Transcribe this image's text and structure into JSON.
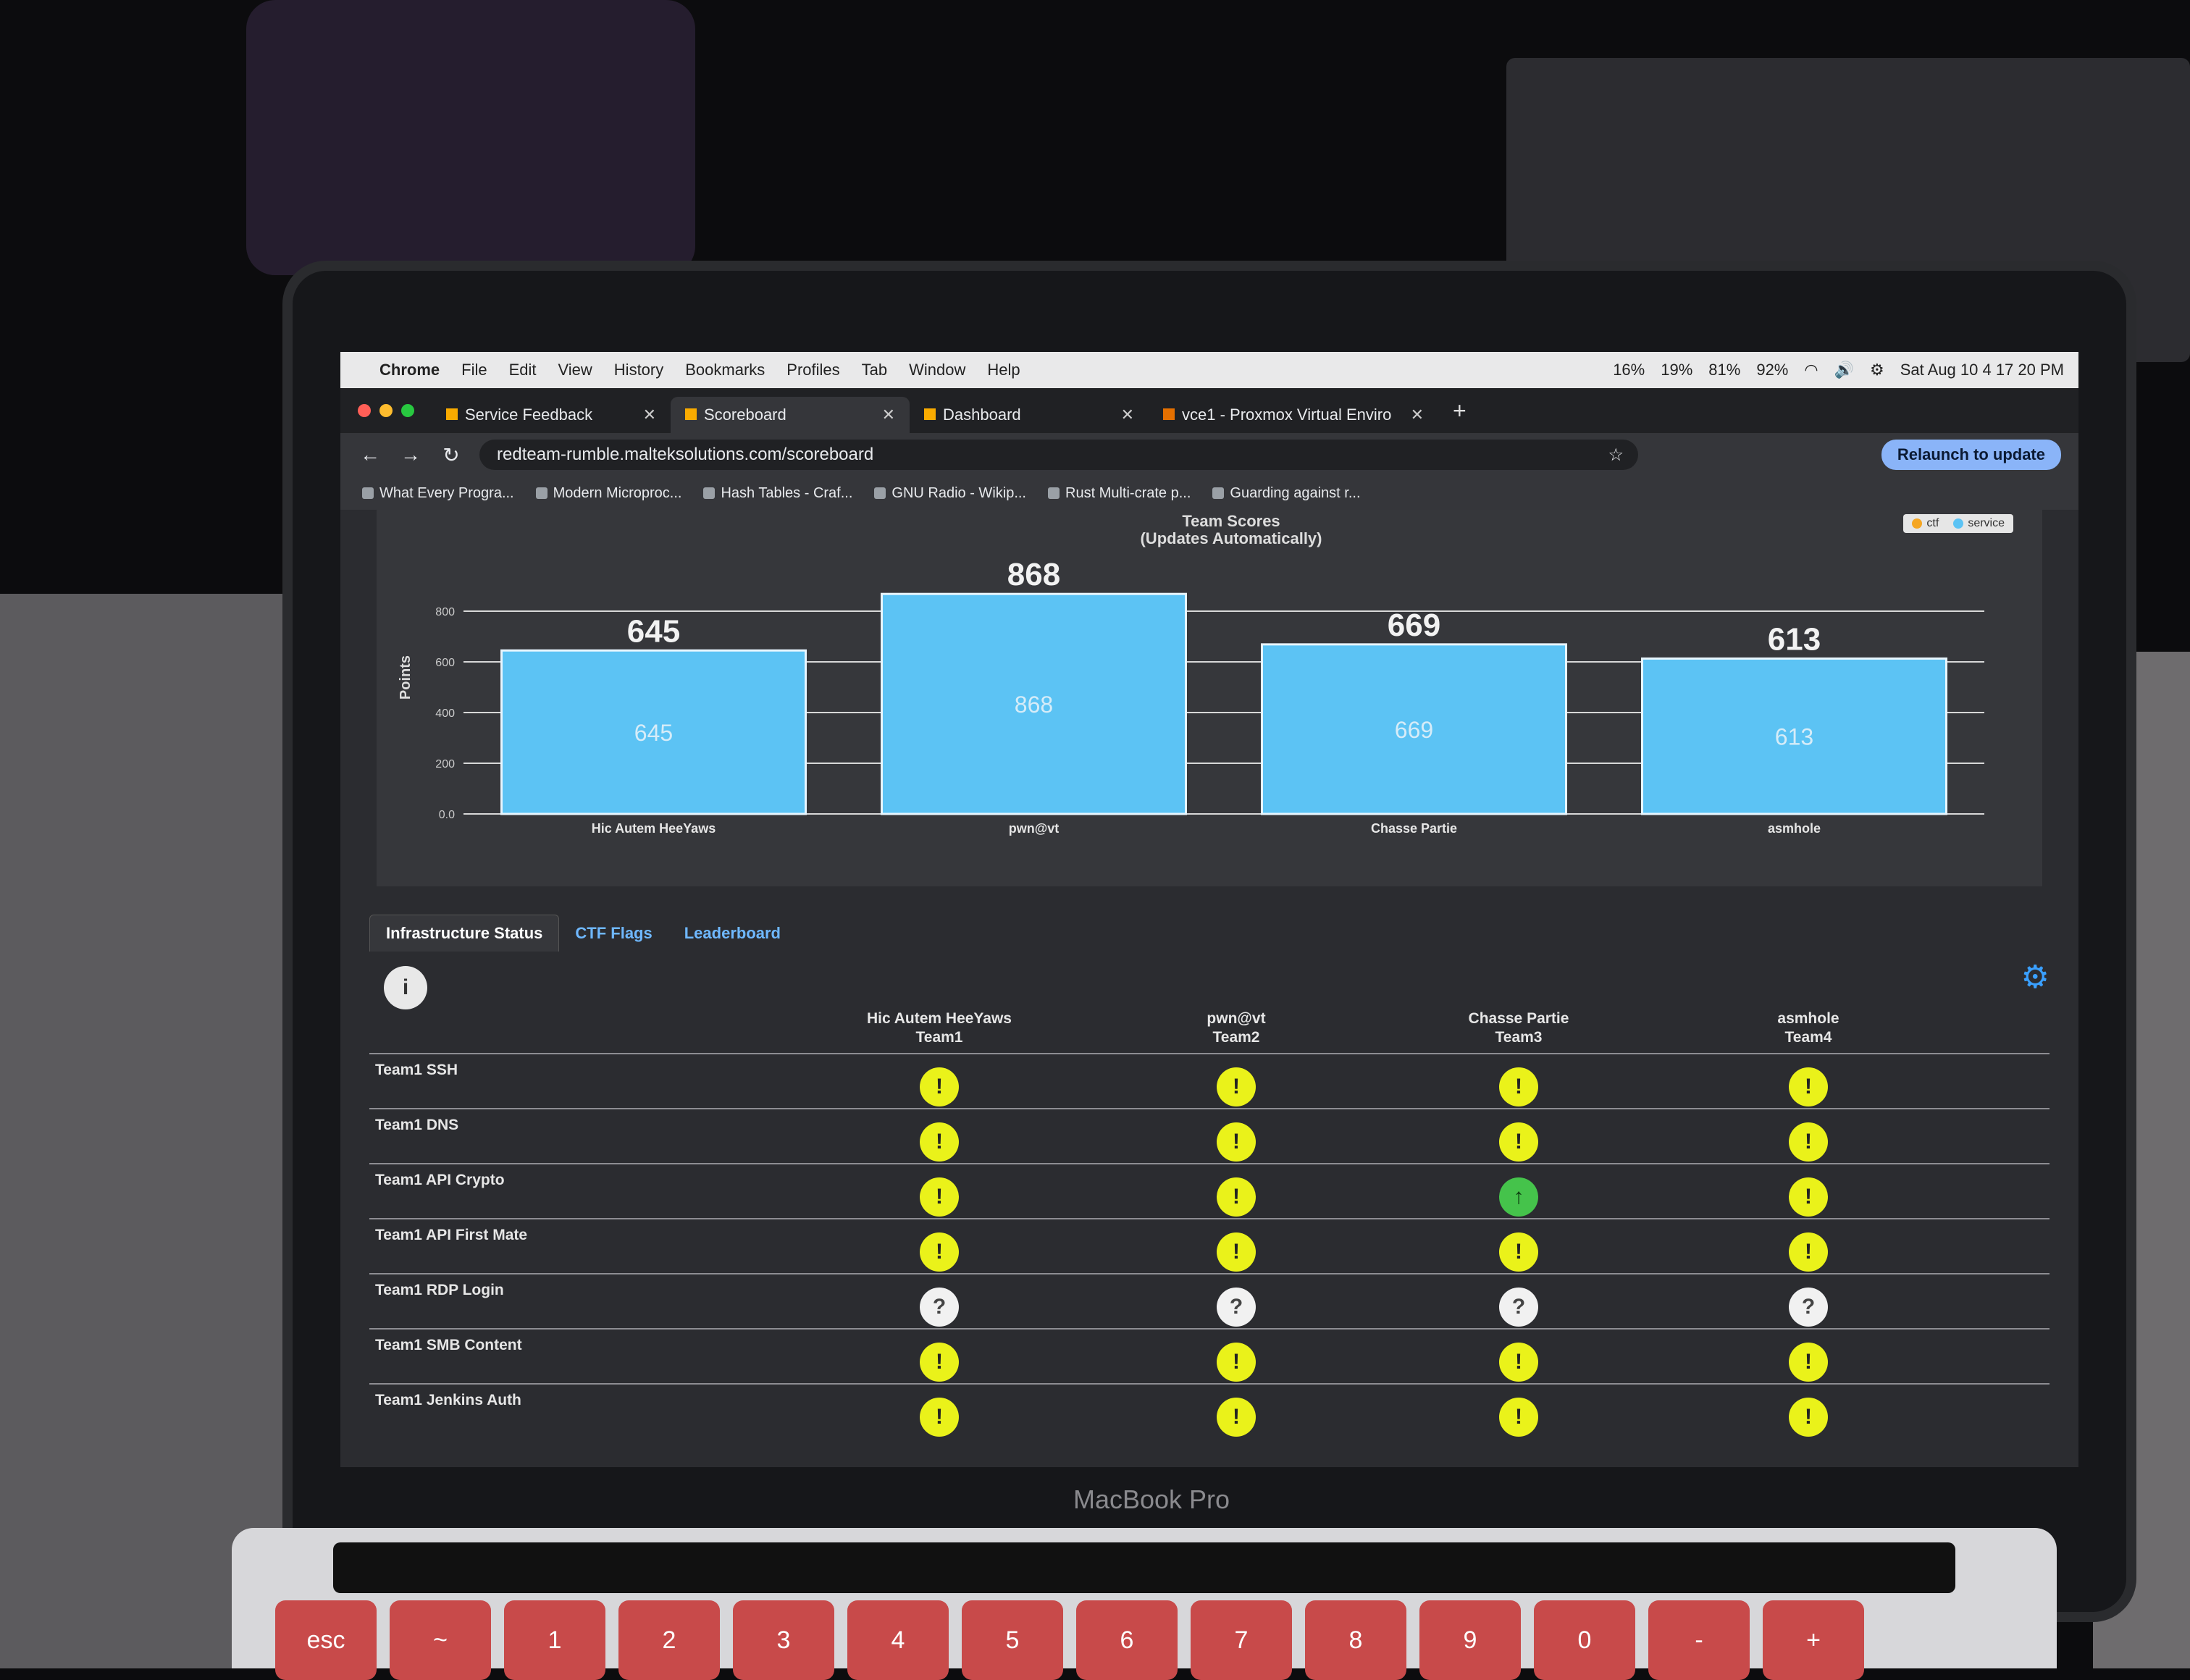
{
  "device": {
    "label": "MacBook Pro"
  },
  "keyboard": {
    "keys": [
      "esc",
      "~",
      "1",
      "2",
      "3",
      "4",
      "5",
      "6",
      "7",
      "8",
      "9",
      "0",
      "-",
      "+"
    ]
  },
  "menubar": {
    "app": "Chrome",
    "items": [
      "File",
      "Edit",
      "View",
      "History",
      "Bookmarks",
      "Profiles",
      "Tab",
      "Window",
      "Help"
    ],
    "stats": [
      "16%",
      "19%",
      "81%",
      "92%"
    ],
    "clock": "Sat Aug 10  4 17 20 PM"
  },
  "tabs": [
    {
      "title": "Service Feedback",
      "active": false
    },
    {
      "title": "Scoreboard",
      "active": true
    },
    {
      "title": "Dashboard",
      "active": false
    },
    {
      "title": "vce1 - Proxmox Virtual Enviro",
      "active": false
    }
  ],
  "address": {
    "url": "redteam-rumble.malteksolutions.com/scoreboard",
    "relaunch": "Relaunch to update"
  },
  "bookmarks": [
    "What Every Progra...",
    "Modern Microproc...",
    "Hash Tables - Craf...",
    "GNU Radio - Wikip...",
    "Rust Multi-crate p...",
    "Guarding against r..."
  ],
  "chart_data": {
    "type": "bar",
    "title": "Team Scores\n(Updates Automatically)",
    "ylabel": "Points",
    "categories": [
      "Hic Autem HeeYaws",
      "pwn@vt",
      "Chasse Partie",
      "asmhole"
    ],
    "values": [
      645,
      868,
      669,
      613
    ],
    "ylim": [
      0,
      1000
    ],
    "yticks": [
      "0.0",
      "200",
      "400",
      "600",
      "800"
    ],
    "legend": [
      "ctf",
      "service"
    ],
    "colors": {
      "bar": "#5cc3f4",
      "grid": "#d8d8d8"
    }
  },
  "page_tabs": [
    "Infrastructure Status",
    "CTF Flags",
    "Leaderboard"
  ],
  "info_icon": "i",
  "teams": [
    {
      "name": "Hic Autem HeeYaws",
      "id": "Team1"
    },
    {
      "name": "pwn@vt",
      "id": "Team2"
    },
    {
      "name": "Chasse Partie",
      "id": "Team3"
    },
    {
      "name": "asmhole",
      "id": "Team4"
    }
  ],
  "services": [
    {
      "name": "Team1 SSH",
      "status": [
        "warn",
        "warn",
        "warn",
        "warn"
      ]
    },
    {
      "name": "Team1 DNS",
      "status": [
        "warn",
        "warn",
        "warn",
        "warn"
      ]
    },
    {
      "name": "Team1 API Crypto",
      "status": [
        "warn",
        "warn",
        "up",
        "warn"
      ]
    },
    {
      "name": "Team1 API First Mate",
      "status": [
        "warn",
        "warn",
        "warn",
        "warn"
      ]
    },
    {
      "name": "Team1 RDP Login",
      "status": [
        "unknown",
        "unknown",
        "unknown",
        "unknown"
      ]
    },
    {
      "name": "Team1 SMB Content",
      "status": [
        "warn",
        "warn",
        "warn",
        "warn"
      ]
    },
    {
      "name": "Team1 Jenkins Auth",
      "status": [
        "warn",
        "warn",
        "warn",
        "warn"
      ]
    }
  ],
  "status_glyphs": {
    "warn": "!",
    "up": "↑",
    "unknown": "?"
  }
}
